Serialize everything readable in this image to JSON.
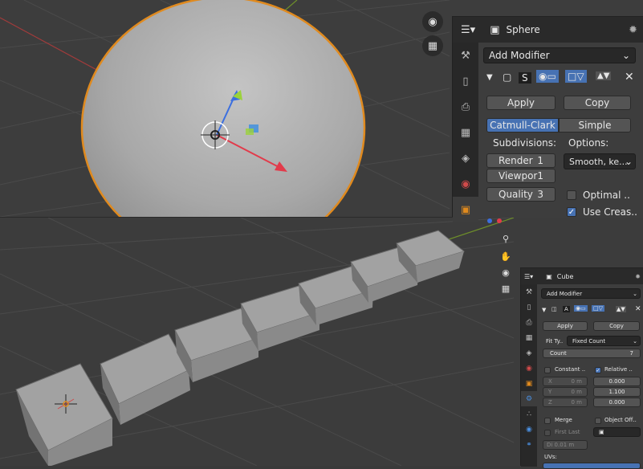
{
  "panel1": {
    "object_name": "Sphere",
    "add_modifier": "Add Modifier",
    "modifier_short": "S",
    "apply": "Apply",
    "copy": "Copy",
    "subdiv_types": [
      "Catmull-Clark",
      "Simple"
    ],
    "subdivisions_label": "Subdivisions:",
    "options_label": "Options:",
    "render_label": "Render",
    "render_value": "1",
    "viewport_label": "Viewpor",
    "viewport_value": "1",
    "quality_label": "Quality",
    "quality_value": "3",
    "uv_smooth": "Smooth, ke...",
    "optimal_label": "Optimal ..",
    "use_crease_label": "Use Creas.."
  },
  "panel2": {
    "object_name": "Cube",
    "add_modifier": "Add Modifier",
    "modifier_short": "A",
    "apply": "Apply",
    "copy": "Copy",
    "fit_type_label": "Fit Ty..",
    "fit_type_value": "Fixed Count",
    "count_label": "Count",
    "count_value": "7",
    "constant_label": "Constant ..",
    "relative_label": "Relative ..",
    "const_fields": [
      {
        "axis": "X",
        "value": "0 m"
      },
      {
        "axis": "Y",
        "value": "0 m"
      },
      {
        "axis": "Z",
        "value": "0 m"
      }
    ],
    "relative_values": [
      "0.000",
      "1.100",
      "0.000"
    ],
    "merge_label": "Merge",
    "object_offset_label": "Object Off..",
    "first_last_label": "First Last",
    "distance_value": "Di  0.01 m",
    "uvs_label": "UVs:"
  }
}
